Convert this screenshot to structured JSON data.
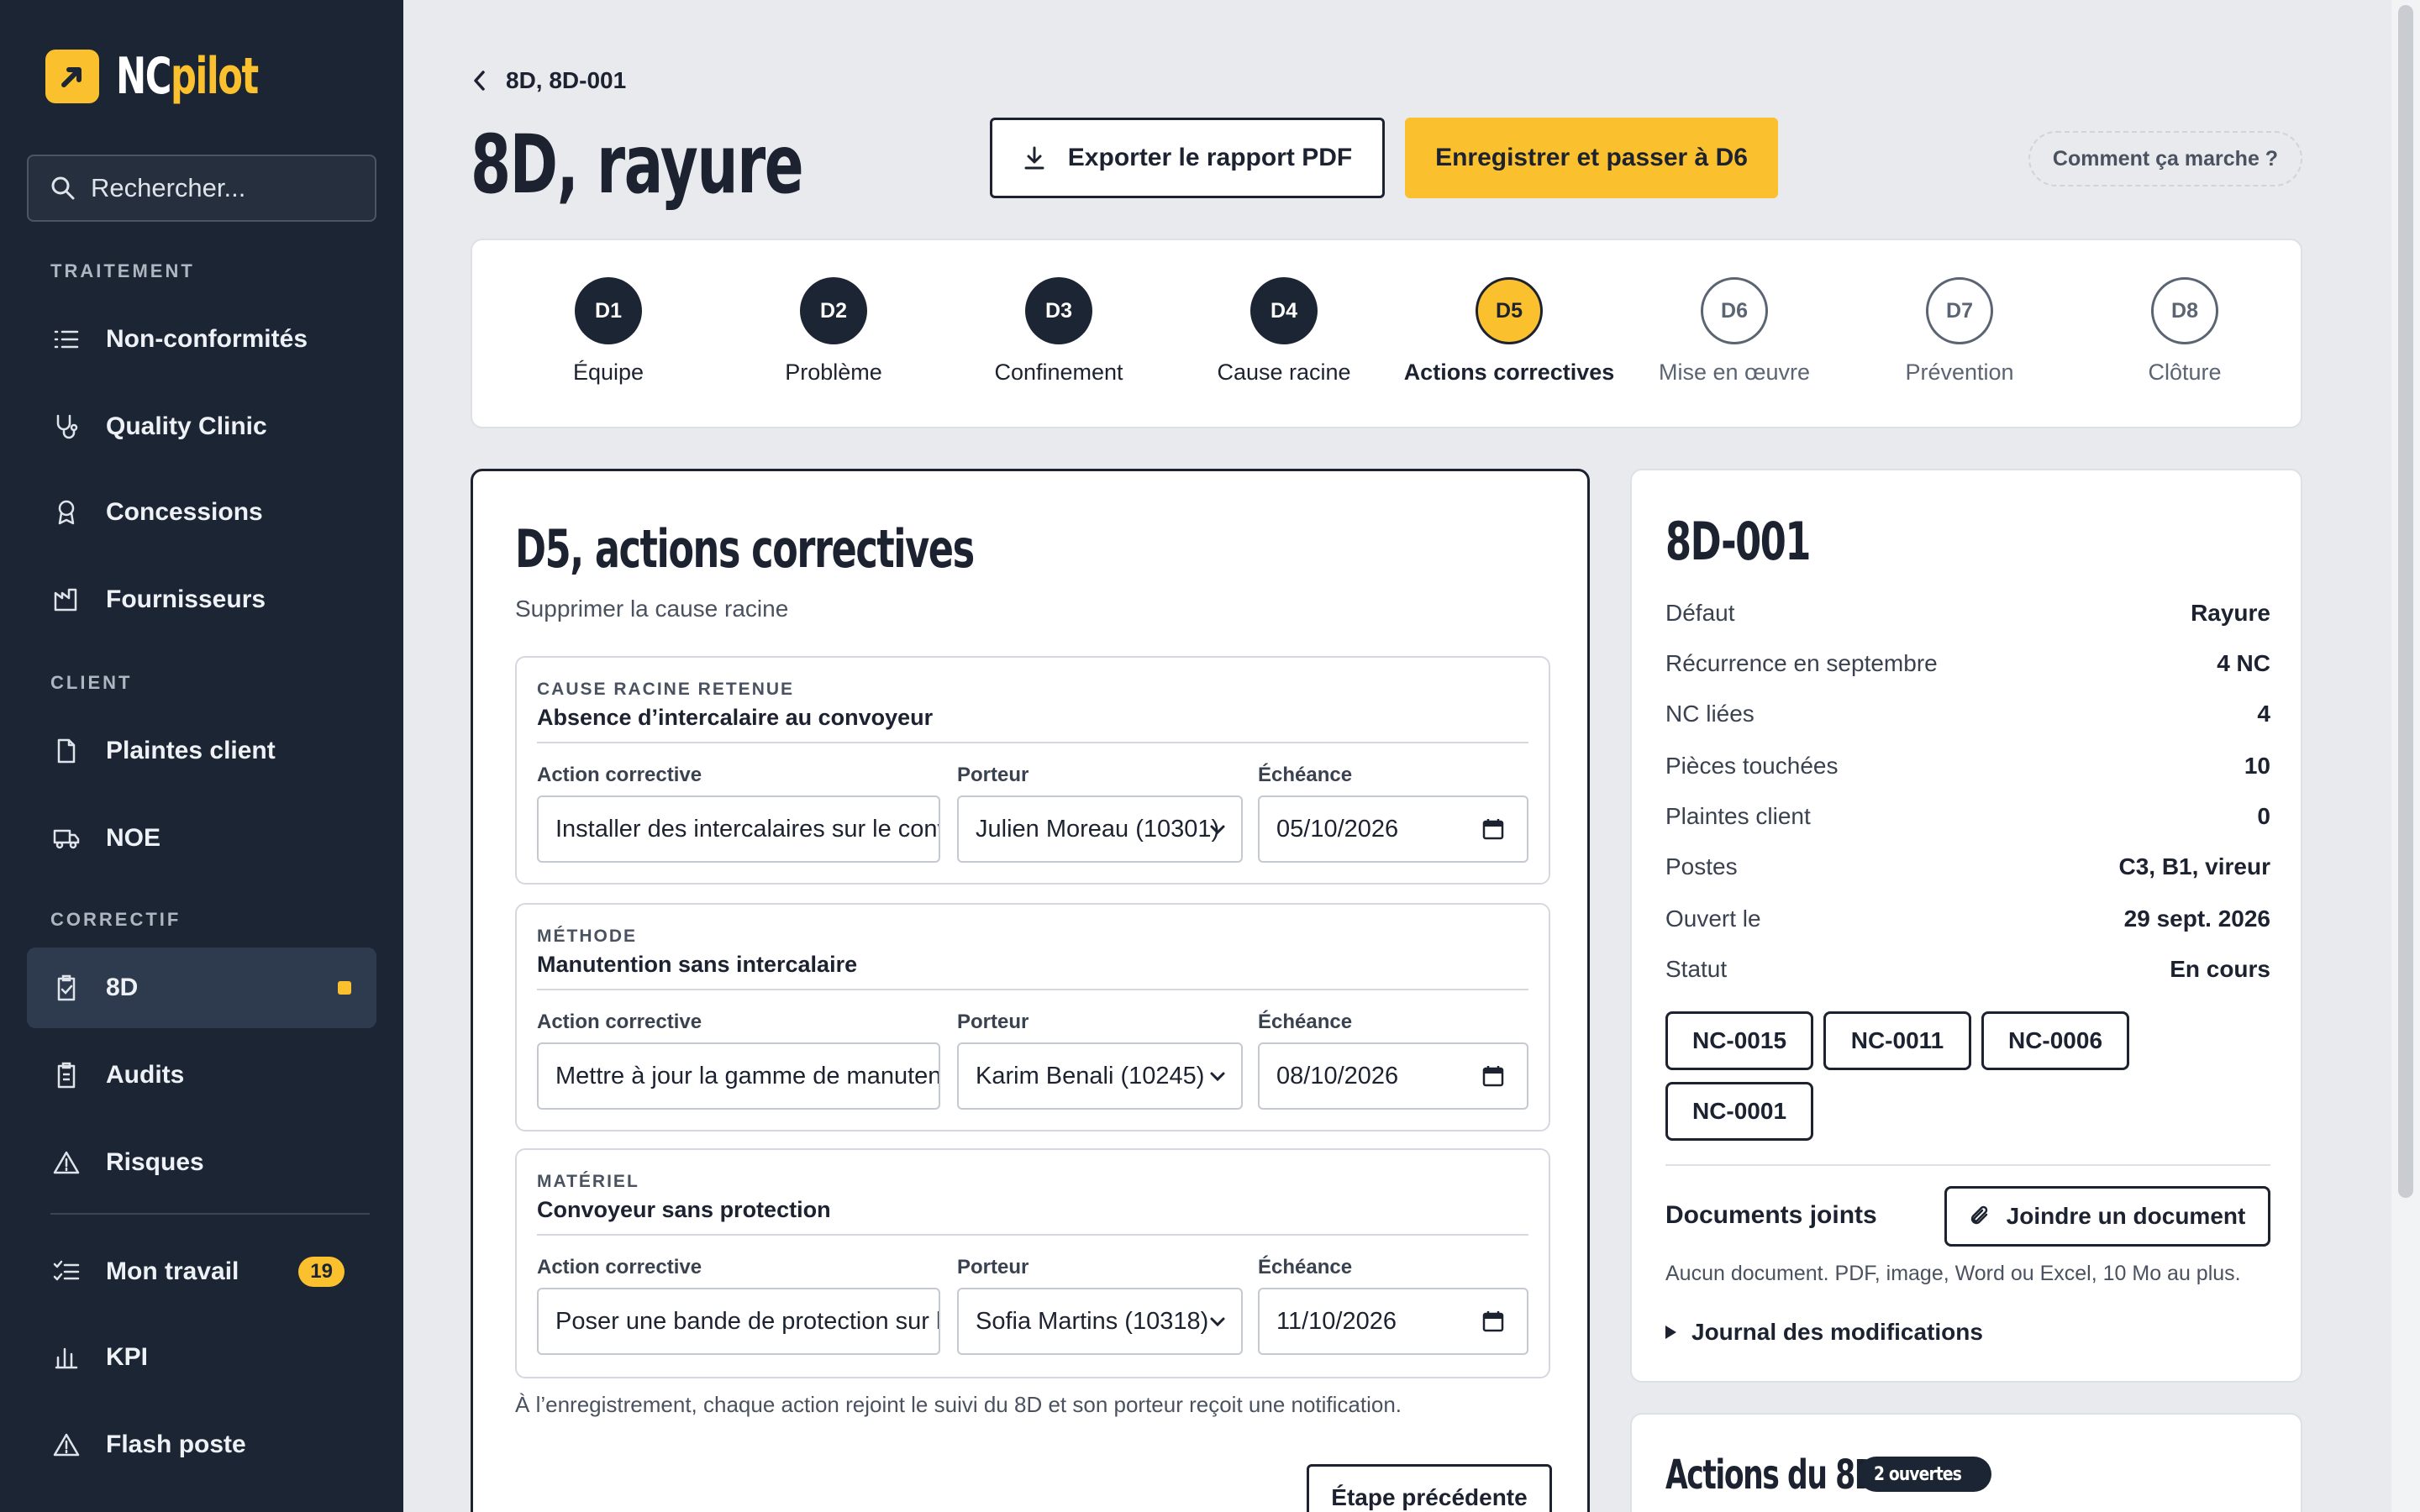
{
  "app": {
    "logo_nc": "NC",
    "logo_pilot": "pilot"
  },
  "sidebar": {
    "search_placeholder": "Rechercher...",
    "sections": {
      "traitement": "TRAITEMENT",
      "client": "CLIENT",
      "correctif": "CORRECTIF"
    },
    "items": {
      "nonconformites": "Non-conformités",
      "quality_clinic": "Quality Clinic",
      "concessions": "Concessions",
      "fournisseurs": "Fournisseurs",
      "plaintes": "Plaintes client",
      "noe": "NOE",
      "eightd": "8D",
      "audits": "Audits",
      "risques": "Risques",
      "mon_travail": "Mon travail",
      "mon_travail_badge": "19",
      "kpi": "KPI",
      "flash": "Flash poste"
    }
  },
  "header": {
    "breadcrumb": "8D, 8D-001",
    "title": "8D, rayure",
    "export_label": "Exporter le rapport PDF",
    "save_label": "Enregistrer et passer à D6",
    "help_label": "Comment ça marche ?"
  },
  "stepper": [
    {
      "code": "D1",
      "label": "Équipe",
      "state": "done"
    },
    {
      "code": "D2",
      "label": "Problème",
      "state": "done"
    },
    {
      "code": "D3",
      "label": "Confinement",
      "state": "done"
    },
    {
      "code": "D4",
      "label": "Cause racine",
      "state": "done"
    },
    {
      "code": "D5",
      "label": "Actions correctives",
      "state": "current"
    },
    {
      "code": "D6",
      "label": "Mise en œuvre",
      "state": "todo"
    },
    {
      "code": "D7",
      "label": "Prévention",
      "state": "todo"
    },
    {
      "code": "D8",
      "label": "Clôture",
      "state": "todo"
    }
  ],
  "form": {
    "title": "D5, actions correctives",
    "subtitle": "Supprimer la cause racine",
    "field_labels": {
      "action": "Action corrective",
      "porteur": "Porteur",
      "echeance": "Échéance"
    },
    "groups": [
      {
        "caption": "CAUSE RACINE RETENUE",
        "title": "Absence d’intercalaire au convoyeur",
        "action": "Installer des intercalaires sur le convoyeur",
        "porteur": "Julien Moreau (10301)",
        "echeance": "05/10/2026"
      },
      {
        "caption": "MÉTHODE",
        "title": "Manutention sans intercalaire",
        "action": "Mettre à jour la gamme de manutention",
        "porteur": "Karim Benali (10245)",
        "echeance": "08/10/2026"
      },
      {
        "caption": "MATÉRIEL",
        "title": "Convoyeur sans protection",
        "action": "Poser une bande de protection sur le convoyeur",
        "porteur": "Sofia Martins (10318)",
        "echeance": "11/10/2026"
      }
    ],
    "note": "À l’enregistrement, chaque action rejoint le suivi du 8D et son porteur reçoit une notification.",
    "prev_label": "Étape précédente"
  },
  "info": {
    "title": "8D-001",
    "rows": [
      {
        "k": "Défaut",
        "v": "Rayure"
      },
      {
        "k": "Récurrence en septembre",
        "v": "4 NC"
      },
      {
        "k": "NC liées",
        "v": "4"
      },
      {
        "k": "Pièces touchées",
        "v": "10"
      },
      {
        "k": "Plaintes client",
        "v": "0"
      },
      {
        "k": "Postes",
        "v": "C3, B1, vireur"
      },
      {
        "k": "Ouvert le",
        "v": "29 sept. 2026"
      },
      {
        "k": "Statut",
        "v": "En cours"
      }
    ],
    "chips": [
      "NC-0015",
      "NC-0011",
      "NC-0006",
      "NC-0001"
    ],
    "docs_label": "Documents joints",
    "attach_label": "Joindre un document",
    "docs_hint": "Aucun document. PDF, image, Word ou Excel, 10 Mo au plus.",
    "journal_label": "Journal des modifications"
  },
  "actions": {
    "title": "Actions du 8D",
    "badge": "2 ouvertes"
  },
  "colors": {
    "sidebar": "#1c2533",
    "accent": "#fbc02d",
    "ink": "#1c2230",
    "background": "#e8eaed"
  }
}
